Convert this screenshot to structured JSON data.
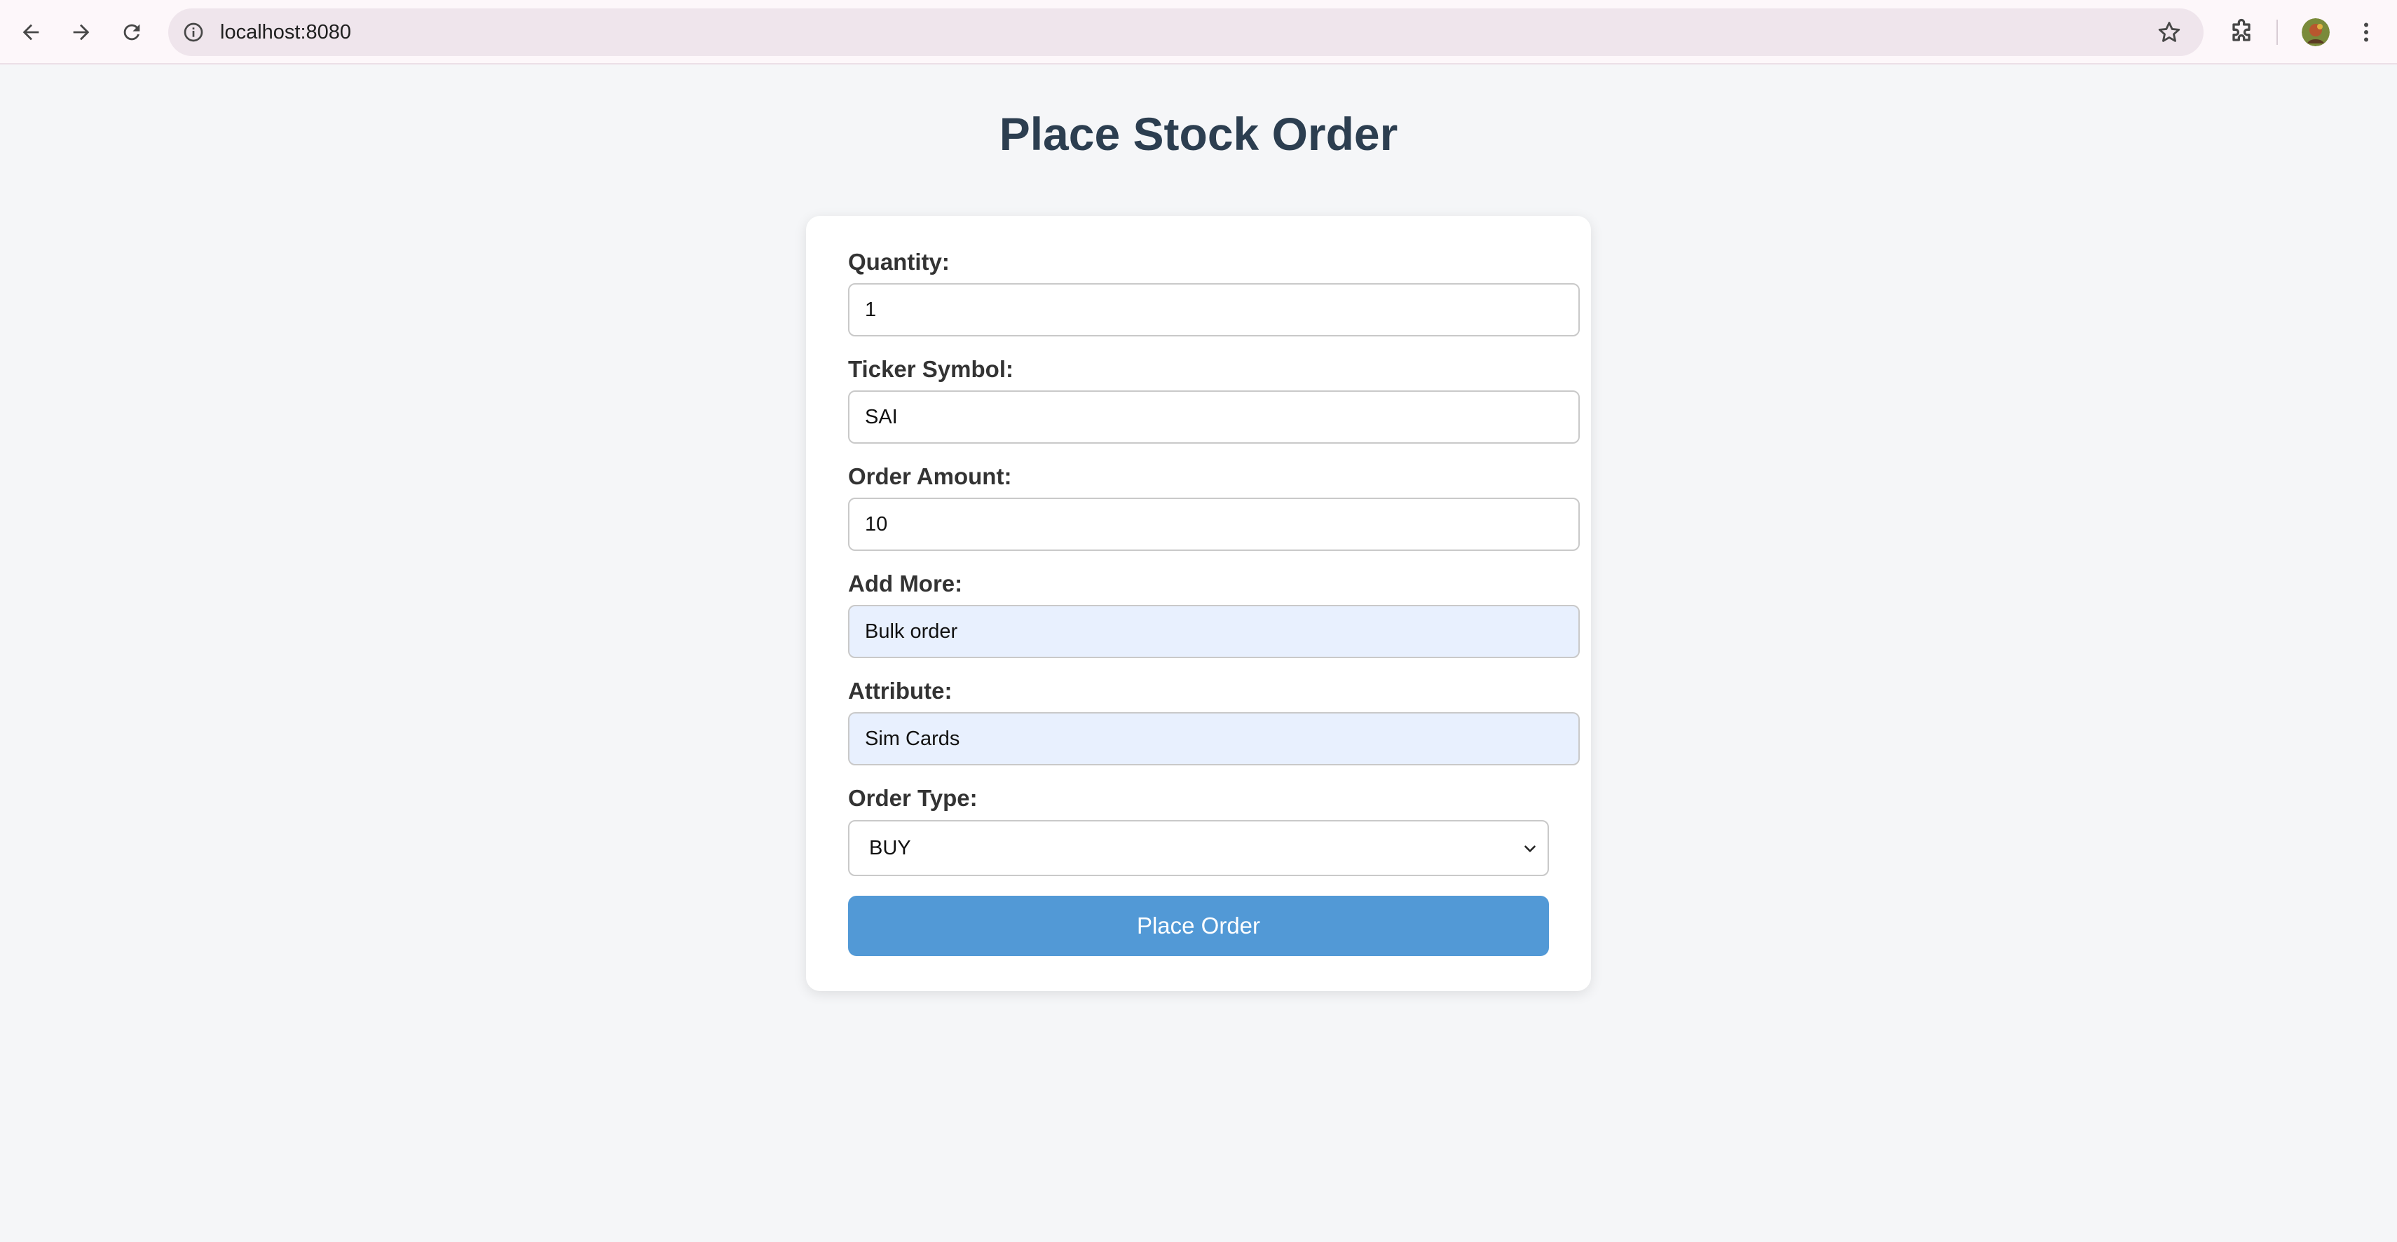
{
  "browser": {
    "url": "localhost:8080",
    "icons": {
      "back": "arrow-left",
      "forward": "arrow-right",
      "reload": "reload",
      "site_info": "info-circle",
      "bookmark": "star-outline",
      "extensions": "puzzle-piece",
      "profile": "avatar",
      "menu": "vertical-dots"
    }
  },
  "page": {
    "title": "Place Stock Order"
  },
  "form": {
    "fields": [
      {
        "label": "Quantity:",
        "value": "1",
        "autofilled": false
      },
      {
        "label": "Ticker Symbol:",
        "value": "SAI",
        "autofilled": false
      },
      {
        "label": "Order Amount:",
        "value": "10",
        "autofilled": false
      },
      {
        "label": "Add More:",
        "value": "Bulk order",
        "autofilled": true
      },
      {
        "label": "Attribute:",
        "value": "Sim Cards",
        "autofilled": true
      }
    ],
    "order_type": {
      "label": "Order Type:",
      "selected": "BUY"
    },
    "submit_label": "Place Order"
  },
  "colors": {
    "title": "#2c3e50",
    "button": "#5299d6",
    "autofill_bg": "#e8f0fe",
    "page_bg": "#f5f6f8"
  }
}
